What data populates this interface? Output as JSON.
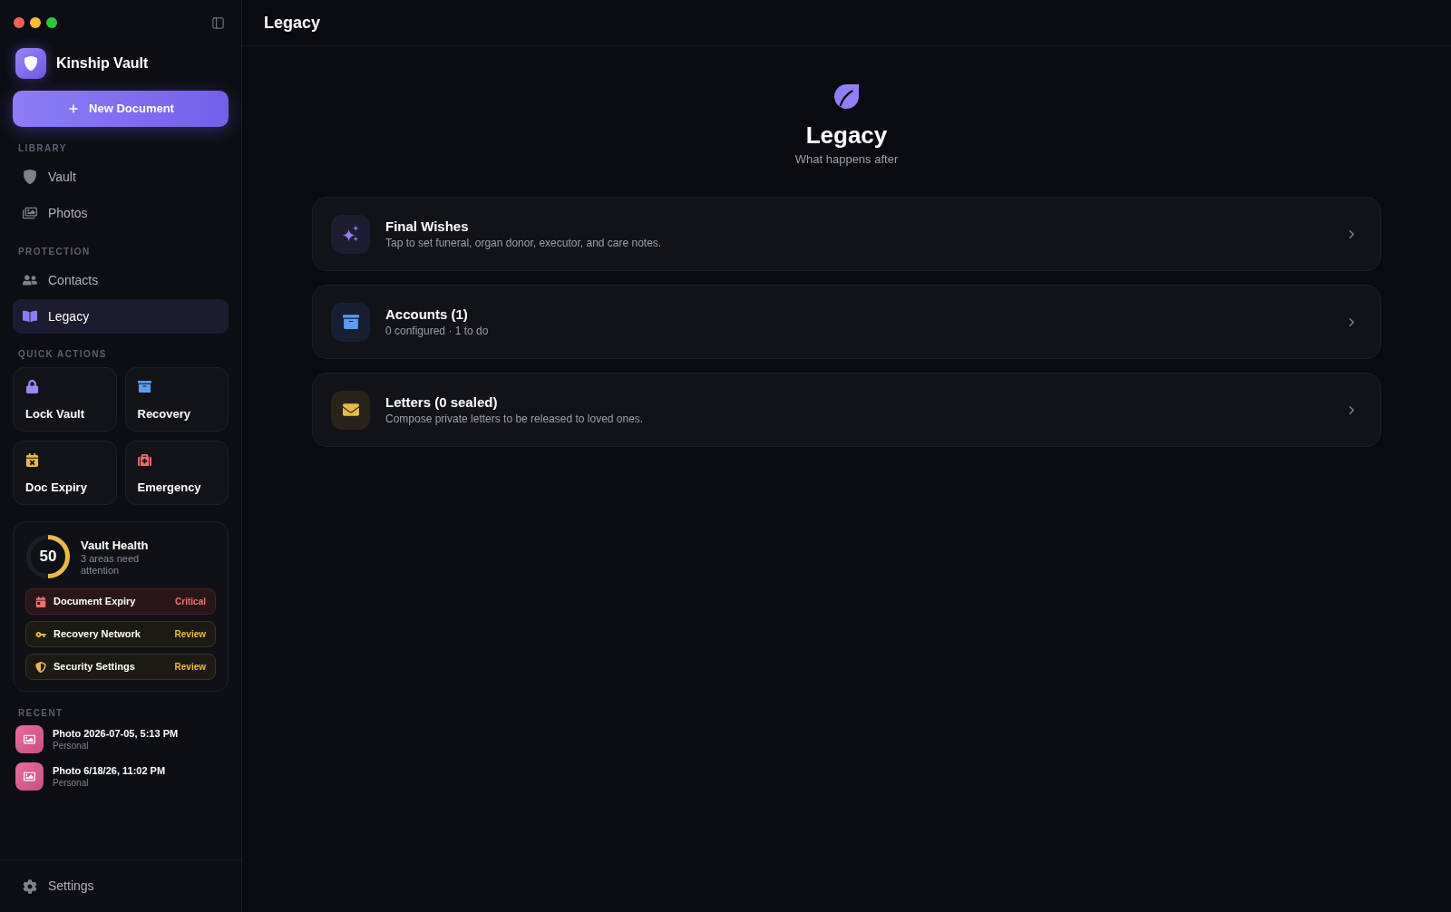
{
  "app": {
    "name": "Kinship Vault"
  },
  "new_document_button": {
    "label": "New Document"
  },
  "nav_sections": [
    {
      "label": "LIBRARY",
      "items": [
        {
          "label": "Vault",
          "selected": false
        },
        {
          "label": "Photos",
          "selected": false
        }
      ]
    },
    {
      "label": "PROTECTION",
      "items": [
        {
          "label": "Contacts",
          "selected": false
        },
        {
          "label": "Legacy",
          "selected": true
        }
      ]
    }
  ],
  "quick_actions": {
    "label": "QUICK ACTIONS",
    "items": [
      {
        "label": "Lock Vault"
      },
      {
        "label": "Recovery"
      },
      {
        "label": "Doc Expiry"
      },
      {
        "label": "Emergency"
      }
    ]
  },
  "vault_health": {
    "score": "50",
    "level": 0.5,
    "title": "Vault Health",
    "subtitle": "3 areas need attention",
    "items": [
      {
        "label": "Document Expiry",
        "status": "Critical",
        "kind": "critical"
      },
      {
        "label": "Recovery Network",
        "status": "Review",
        "kind": "review"
      },
      {
        "label": "Security Settings",
        "status": "Review",
        "kind": "review"
      }
    ]
  },
  "recent": {
    "label": "RECENT",
    "items": [
      {
        "title": "Photo 2026-07-05, 5:13 PM",
        "subtitle": "Personal"
      },
      {
        "title": "Photo 6/18/26, 11:02 PM",
        "subtitle": "Personal"
      }
    ]
  },
  "settings": {
    "label": "Settings"
  },
  "header": {
    "title": "Legacy"
  },
  "hero": {
    "title": "Legacy",
    "subtitle": "What happens after"
  },
  "cards": [
    {
      "title": "Final Wishes",
      "subtitle": "Tap to set funeral, organ donor, executor, and care notes."
    },
    {
      "title": "Accounts (1)",
      "subtitle": "0 configured · 1 to do"
    },
    {
      "title": "Letters (0 sealed)",
      "subtitle": "Compose private letters to be released to loved ones."
    }
  ]
}
